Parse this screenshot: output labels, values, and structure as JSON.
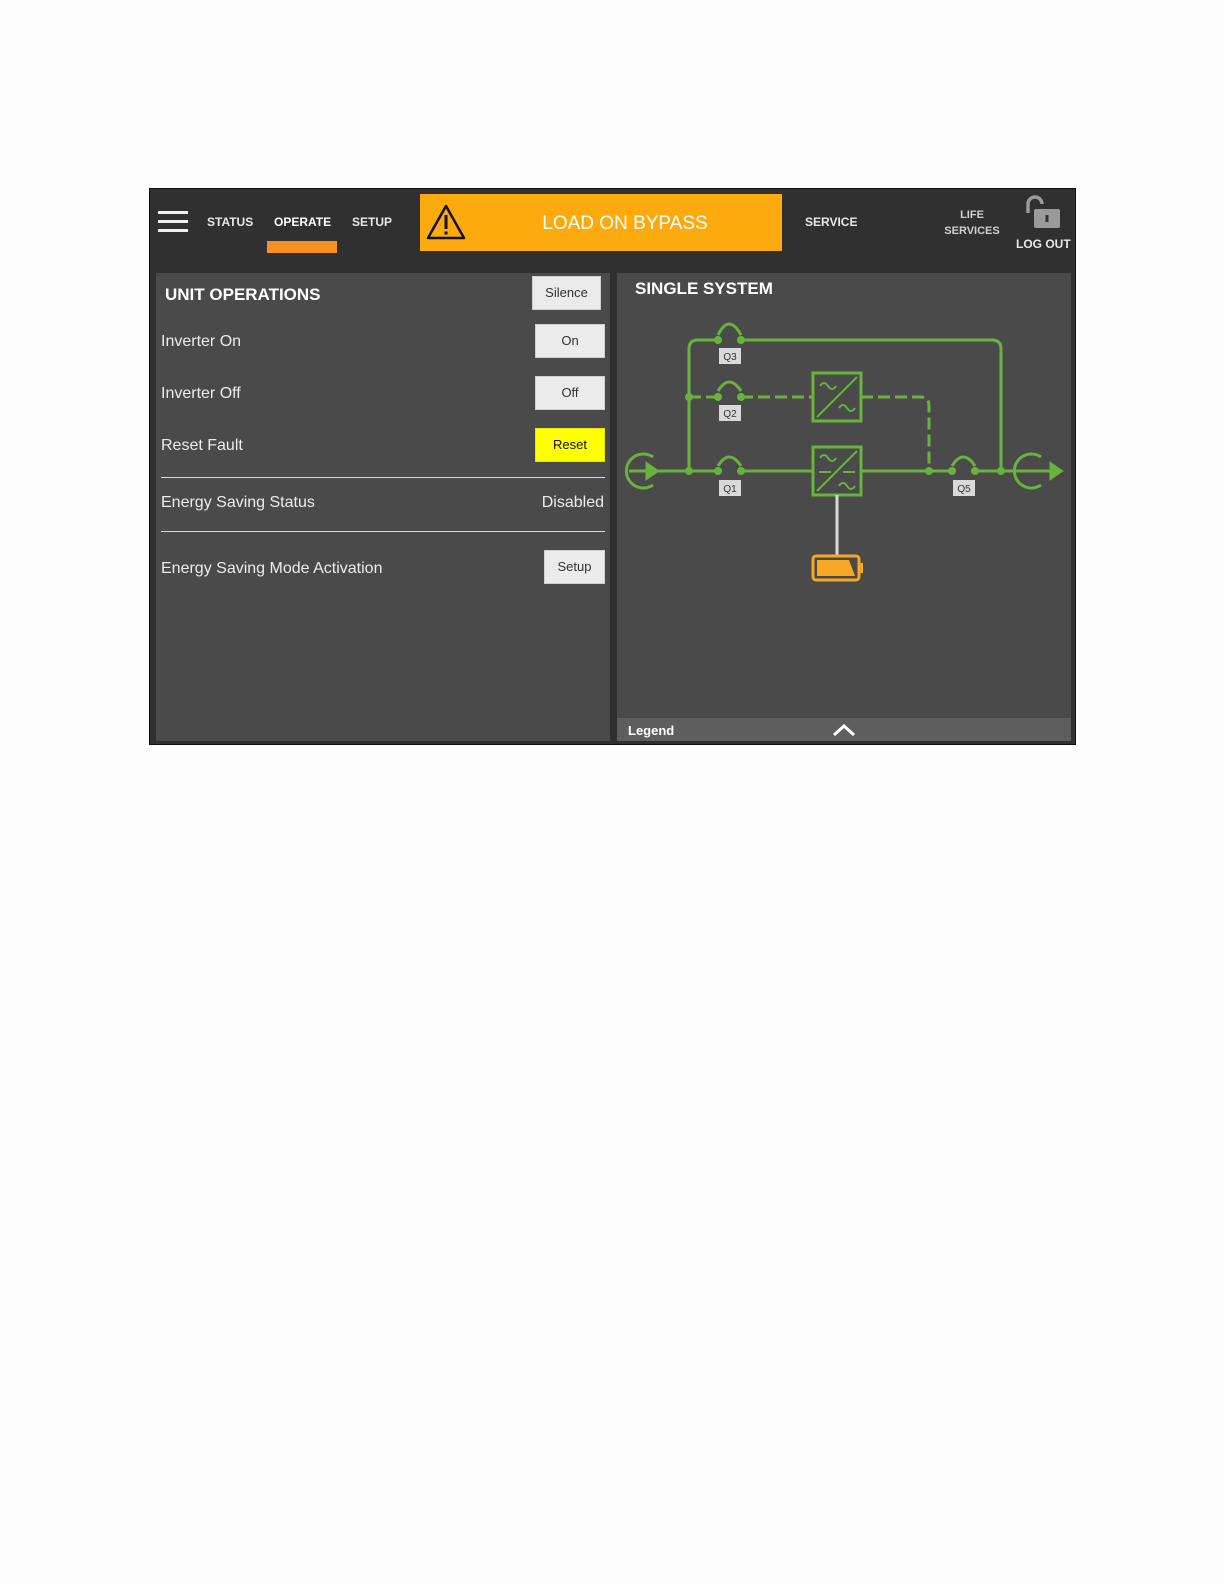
{
  "nav": {
    "status": "STATUS",
    "operate": "OPERATE",
    "setup": "SETUP",
    "service": "SERVICE",
    "life_line1": "LIFE",
    "life_line2": "SERVICES",
    "logout": "LOG OUT",
    "active": "operate"
  },
  "alarm": {
    "text": "LOAD ON BYPASS",
    "color": "#fcaa0d"
  },
  "unit_operations": {
    "title": "UNIT OPERATIONS",
    "silence": "Silence",
    "rows": [
      {
        "label": "Inverter On",
        "button": "On"
      },
      {
        "label": "Inverter Off",
        "button": "Off"
      },
      {
        "label": "Reset Fault",
        "button": "Reset"
      }
    ],
    "energy_status_label": "Energy Saving Status",
    "energy_status_value": "Disabled",
    "energy_mode_label": "Energy Saving Mode Activation",
    "energy_mode_button": "Setup"
  },
  "single_system": {
    "title": "SINGLE SYSTEM",
    "breakers": {
      "q1": "Q1",
      "q2": "Q2",
      "q3": "Q3",
      "q5": "Q5"
    },
    "legend": "Legend",
    "flow_color": "#6ab23e",
    "battery_color": "#f7a823"
  },
  "icons": [
    "menu-icon",
    "warning-icon",
    "unlock-icon",
    "chevron-up-icon",
    "input-icon",
    "output-icon",
    "rectifier-icon",
    "inverter-icon",
    "battery-icon"
  ]
}
